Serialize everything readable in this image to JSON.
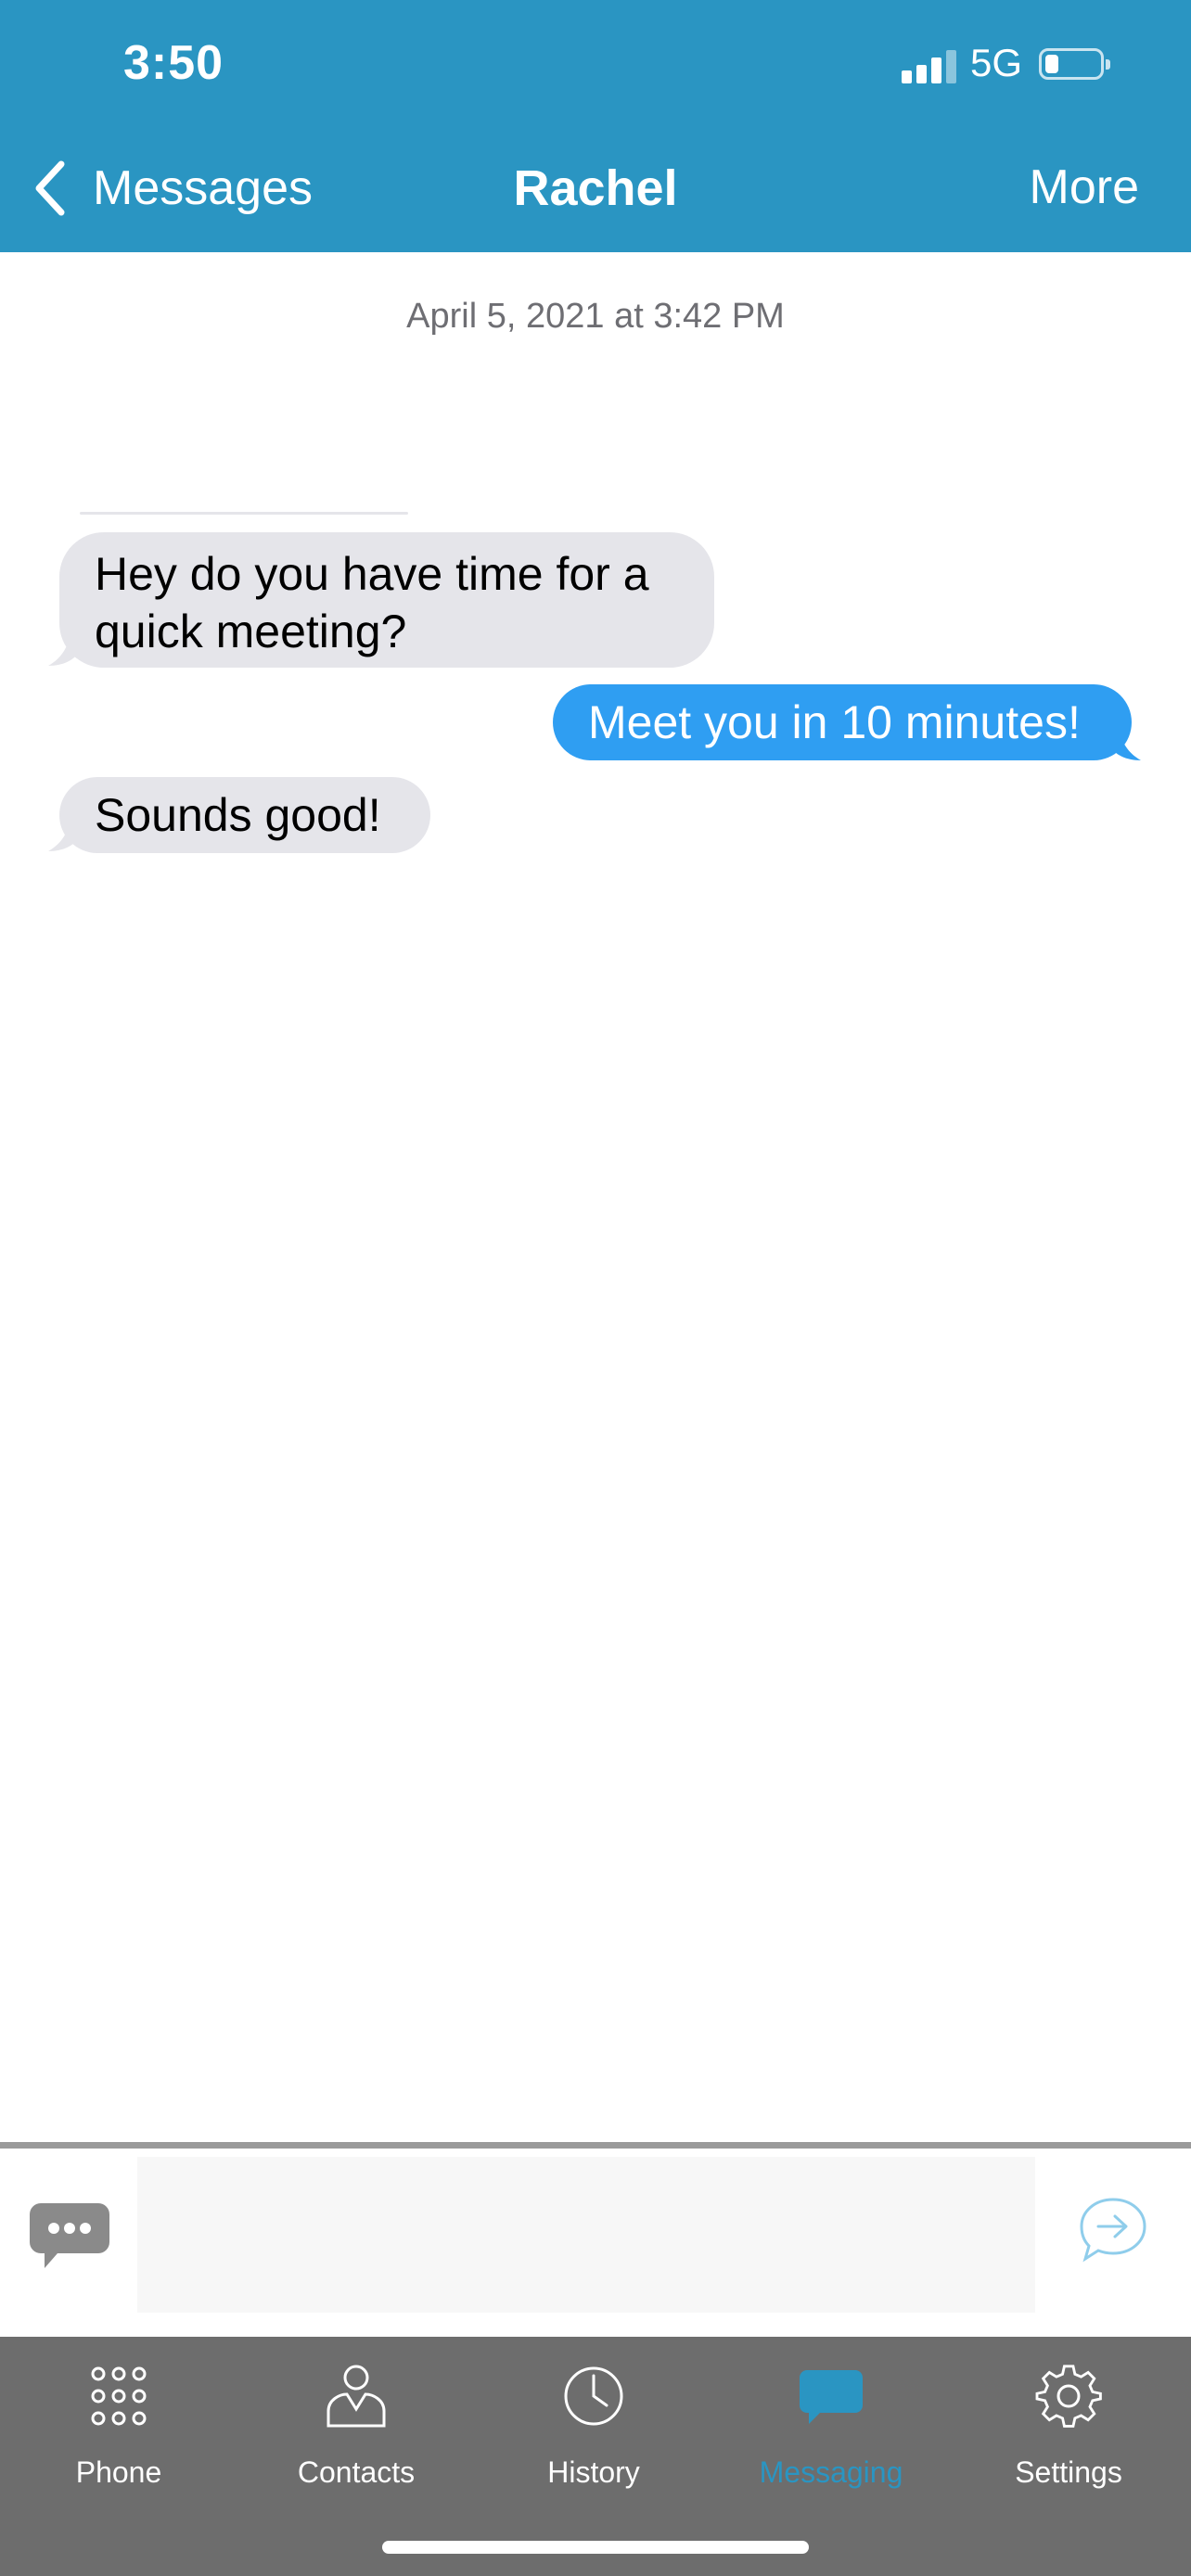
{
  "status_bar": {
    "time": "3:50",
    "network": "5G"
  },
  "nav": {
    "back_label": "Messages",
    "title": "Rachel",
    "more_label": "More"
  },
  "conversation": {
    "timestamp": "April 5, 2021 at 3:42 PM",
    "messages": [
      {
        "direction": "incoming",
        "text": "Hey do you have time for a quick meeting?"
      },
      {
        "direction": "outgoing",
        "text": "Meet you in 10 minutes!"
      },
      {
        "direction": "incoming",
        "text": "Sounds good!"
      }
    ]
  },
  "compose": {
    "placeholder": ""
  },
  "tabs": [
    {
      "label": "Phone",
      "icon": "keypad-icon"
    },
    {
      "label": "Contacts",
      "icon": "person-icon"
    },
    {
      "label": "History",
      "icon": "clock-icon"
    },
    {
      "label": "Messaging",
      "icon": "chat-bubble-icon",
      "active": true
    },
    {
      "label": "Settings",
      "icon": "gear-icon"
    }
  ],
  "colors": {
    "header": "#2a95c2",
    "outgoing_bubble": "#2f9ef2",
    "incoming_bubble": "#e5e5ea",
    "tabbar": "#6d6d6d"
  }
}
